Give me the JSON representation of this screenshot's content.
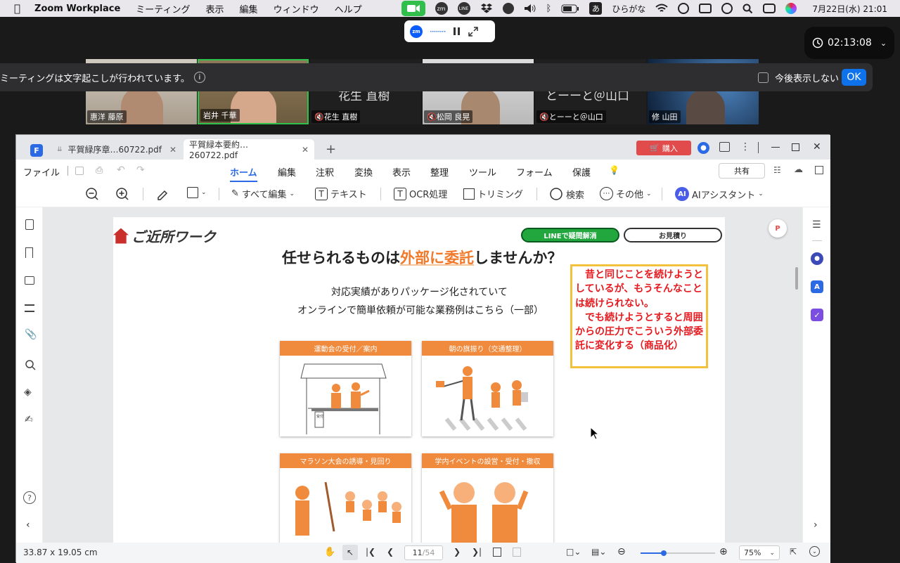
{
  "menubar": {
    "app": "Zoom Workplace",
    "items": [
      "ミーティング",
      "表示",
      "編集",
      "ウィンドウ",
      "ヘルプ"
    ],
    "ime": "あ",
    "ime_label": "ひらがな",
    "clock": "7月22日(水)  21:01"
  },
  "zoom": {
    "timer": "02:13:08",
    "banner_text": "ミーティングは文字起こしが行われています。",
    "checkbox_label": "今後表示しない",
    "ok_label": "OK",
    "participants": [
      {
        "name": "惠洋 藤原",
        "muted": false
      },
      {
        "name": "岩井 千華",
        "muted": false
      },
      {
        "name": "花生 直樹",
        "muted": true,
        "overlay": "花生 直樹"
      },
      {
        "name": "松岡 良晃",
        "muted": true
      },
      {
        "name": "とーーと＠山口",
        "muted": true,
        "overlay": "とーーと＠山口"
      },
      {
        "name": "修 山田",
        "muted": false
      }
    ]
  },
  "pdf": {
    "tabs": [
      "平賀緑序章…60722.pdf",
      "平賀緑本要約…260722.pdf"
    ],
    "buy_label": "購入",
    "file_menu": "ファイル",
    "menus": [
      "ホーム",
      "編集",
      "注釈",
      "変換",
      "表示",
      "整理",
      "ツール",
      "フォーム",
      "保護"
    ],
    "share_label": "共有",
    "tools": [
      "すべて編集",
      "テキスト",
      "OCR処理",
      "トリミング",
      "検索",
      "その他",
      "AIアシスタント"
    ],
    "ai_badge": "AI",
    "status": {
      "size": "33.87 x 19.05 cm",
      "page": "11",
      "total": "/54",
      "zoom": "75%"
    }
  },
  "slide": {
    "logo": "ご近所ワーク",
    "btn_line": "LINEで疑問解消",
    "btn_quote": "お見積り",
    "title_pre": "任せられるものは",
    "title_em": "外部に委託",
    "title_post": "しませんか？",
    "sub1": "対応実績がありパッケージ化されていて",
    "sub2": "オンラインで簡単依頼が可能な業務例はこちら（一部）",
    "note": "　昔と同じことを続けようとしているが、もうそんなことは続けられない。\n　でも続けようとすると周囲からの圧力でこういう外部委託に変化する（商品化）",
    "cards": [
      "運動会の受付／案内",
      "朝の旗振り（交通整理）",
      "マラソン大会の誘導・見回り",
      "学内イベントの設営・受付・撤収"
    ],
    "booth_sign": "受付"
  },
  "colors": {
    "accent": "#f08a3c",
    "zoom_blue": "#0b5cff",
    "ok_blue": "#0e72ed",
    "pdf_blue": "#2c6ae5",
    "note_red": "#e6191e",
    "note_border": "#f2c23c"
  }
}
